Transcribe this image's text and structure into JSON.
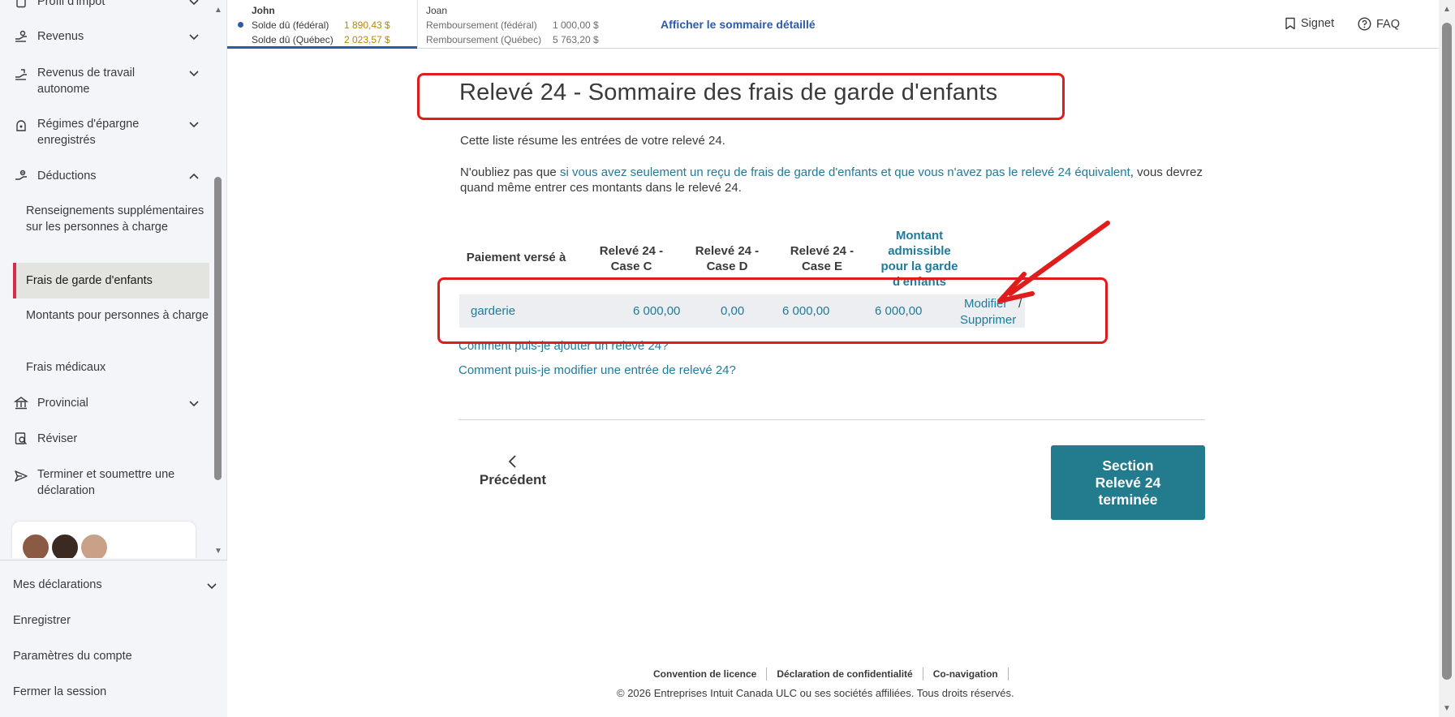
{
  "sidebar": {
    "items": [
      {
        "label": "Profil d'impôt",
        "icon": "document-icon"
      },
      {
        "label": "Revenus",
        "icon": "hand-money-icon"
      },
      {
        "label": "Revenus de travail autonome",
        "icon": "self-employment-icon"
      },
      {
        "label": "Régimes d'épargne enregistrés",
        "icon": "piggy-bank-icon"
      },
      {
        "label": "Déductions",
        "icon": "deductions-icon"
      }
    ],
    "subitems": [
      {
        "label": "Renseignements supplémentaires sur les personnes à charge"
      },
      {
        "label": "Frais de garde d'enfants"
      },
      {
        "label": "Montants pour personnes à charge"
      },
      {
        "label": "Frais médicaux"
      }
    ],
    "items_after": [
      {
        "label": "Provincial",
        "icon": "government-building-icon"
      },
      {
        "label": "Réviser",
        "icon": "review-icon"
      },
      {
        "label": "Terminer et soumettre une déclaration",
        "icon": "send-icon"
      }
    ],
    "bottom": [
      {
        "label": "Mes déclarations"
      },
      {
        "label": "Enregistrer"
      },
      {
        "label": "Paramètres du compte"
      },
      {
        "label": "Fermer la session"
      }
    ]
  },
  "topbar": {
    "john": {
      "name": "John",
      "row1_label": "Solde dû (fédéral)",
      "row1_amount": "1 890,43 $",
      "row2_label": "Solde dû (Québec)",
      "row2_amount": "2 023,57 $"
    },
    "joan": {
      "name": "Joan",
      "row1_label": "Remboursement (fédéral)",
      "row1_amount": "1 000,00 $",
      "row2_label": "Remboursement (Québec)",
      "row2_amount": "5 763,20 $"
    },
    "summary_link": "Afficher le sommaire détaillé",
    "bookmark": "Signet",
    "faq": "FAQ"
  },
  "main": {
    "title": "Relevé 24 - Sommaire des frais de garde d'enfants",
    "intro": "Cette liste résume les entrées de votre relevé 24.",
    "note_prefix": "N'oubliez pas que ",
    "note_link": "si vous avez seulement un reçu de frais de garde d'enfants et que vous n'avez pas le relevé 24 équivalent",
    "note_suffix": ", vous devrez quand même entrer ces montants dans le relevé 24.",
    "table": {
      "headers": {
        "paid_to": "Paiement versé à",
        "case_c_line1": "Relevé 24 -",
        "case_c_line2": "Case C",
        "case_d_line1": "Relevé 24 -",
        "case_d_line2": "Case D",
        "case_e_line1": "Relevé 24 -",
        "case_e_line2": "Case E",
        "amount_line1": "Montant",
        "amount_line2": "admissible",
        "amount_line3": "pour la garde",
        "amount_line4": "d'enfants"
      },
      "rows": [
        {
          "paid_to": "garderie",
          "case_c": "6 000,00",
          "case_d": "0,00",
          "case_e": "6 000,00",
          "amount": "6 000,00",
          "edit": "Modifier",
          "sep": "/",
          "delete": "Supprimer"
        }
      ]
    },
    "help_add": "Comment puis-je ajouter un relevé 24?",
    "help_edit": "Comment puis-je modifier une entrée de relevé 24?",
    "prev_button": "Précédent",
    "done_line1": "Section",
    "done_line2": "Relevé 24",
    "done_line3": "terminée"
  },
  "footer": {
    "links": [
      "Convention de licence",
      "Déclaration de confidentialité",
      "Co-navigation"
    ],
    "copyright": "© 2026 Entreprises Intuit Canada ULC ou ses sociétés affiliées. Tous droits réservés."
  },
  "colors": {
    "accent_teal": "#237b8e",
    "link": "#1f7a9c",
    "annotation_red": "#e01d1d",
    "active_marker": "#d52b4c",
    "owed_amount": "#b8860b"
  }
}
